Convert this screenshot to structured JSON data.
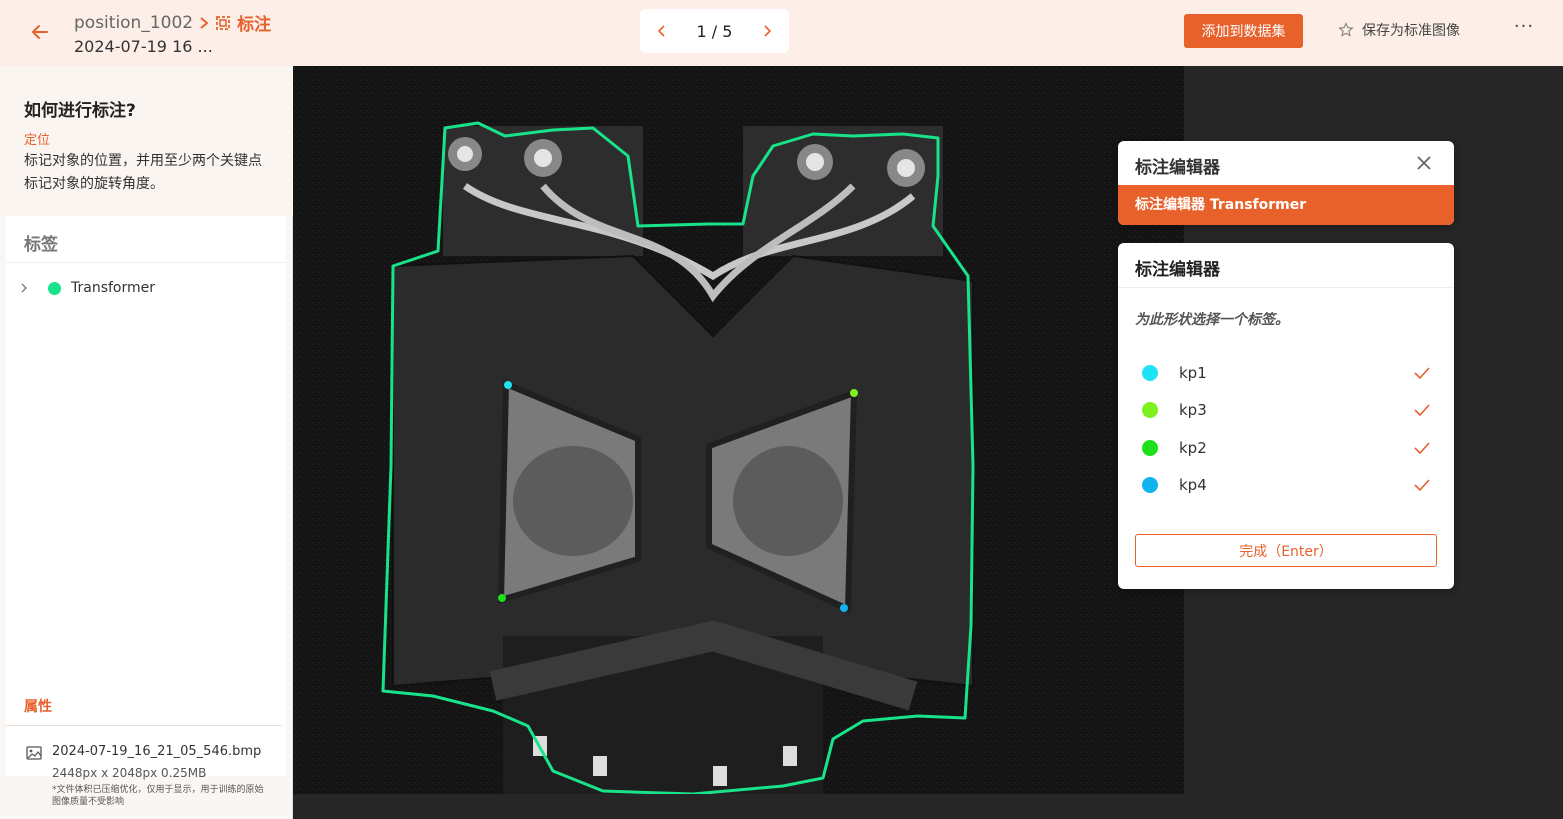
{
  "header": {
    "position": "position_1002",
    "mode_label": "标注",
    "subtitle": "2024-07-19 16 ...",
    "pager": "1 / 5",
    "add_dataset": "添加到数据集",
    "save_standard": "保存为标准图像",
    "more": "···"
  },
  "help": {
    "title": "如何进行标注?",
    "keyword": "定位",
    "text": "标记对象的位置，并用至少两个关键点标记对象的旋转角度。"
  },
  "labels": {
    "heading": "标签",
    "items": [
      {
        "name": "Transformer",
        "color": "#19e38a"
      }
    ]
  },
  "properties": {
    "heading": "属性",
    "file_name": "2024-07-19_16_21_05_546.bmp",
    "file_meta": "2448px x 2048px 0.25MB",
    "note": "*文件体积已压缩优化，仅用于显示，用于训练的原始图像质量不受影响"
  },
  "editor": {
    "title": "标注编辑器",
    "active_item": "标注编辑器 Transformer",
    "panel_title": "标注编辑器",
    "prompt": "为此形状选择一个标签。",
    "keypoints": [
      {
        "name": "kp1",
        "color": "#1fe3f5"
      },
      {
        "name": "kp3",
        "color": "#7ef21f"
      },
      {
        "name": "kp2",
        "color": "#1de01d"
      },
      {
        "name": "kp4",
        "color": "#10b4ee"
      }
    ],
    "done": "完成（Enter）"
  },
  "colors": {
    "accent": "#e8612b",
    "outline": "#19e38a"
  }
}
